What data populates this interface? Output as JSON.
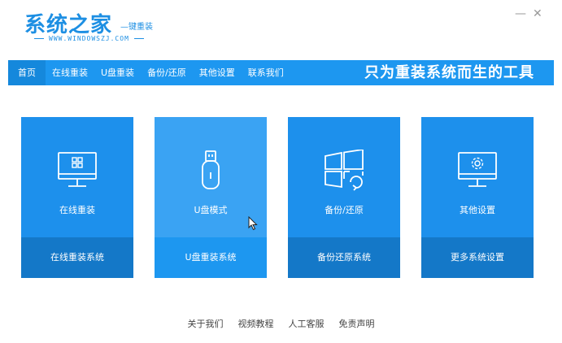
{
  "logo": {
    "main": "系统之家",
    "sub": "—键重装",
    "url": "WWW.WINDOWSZJ.COM"
  },
  "window": {
    "minimize": "—",
    "close": "✕"
  },
  "nav": {
    "items": [
      "首页",
      "在线重装",
      "U盘重装",
      "备份/还原",
      "其他设置",
      "联系我们"
    ],
    "slogan": "只为重装系统而生的工具"
  },
  "cards": [
    {
      "title": "在线重装",
      "action": "在线重装系统",
      "icon": "monitor-windows-icon"
    },
    {
      "title": "U盘模式",
      "action": "U盘重装系统",
      "icon": "usb-drive-icon"
    },
    {
      "title": "备份/还原",
      "action": "备份还原系统",
      "icon": "windows-restore-icon"
    },
    {
      "title": "其他设置",
      "action": "更多系统设置",
      "icon": "monitor-gear-icon"
    }
  ],
  "footer": {
    "links": [
      "关于我们",
      "视频教程",
      "人工客服",
      "免责声明"
    ]
  },
  "colors": {
    "brand": "#1d97f0",
    "card": "#1d90ec",
    "card_bottom": "#1478c8"
  }
}
